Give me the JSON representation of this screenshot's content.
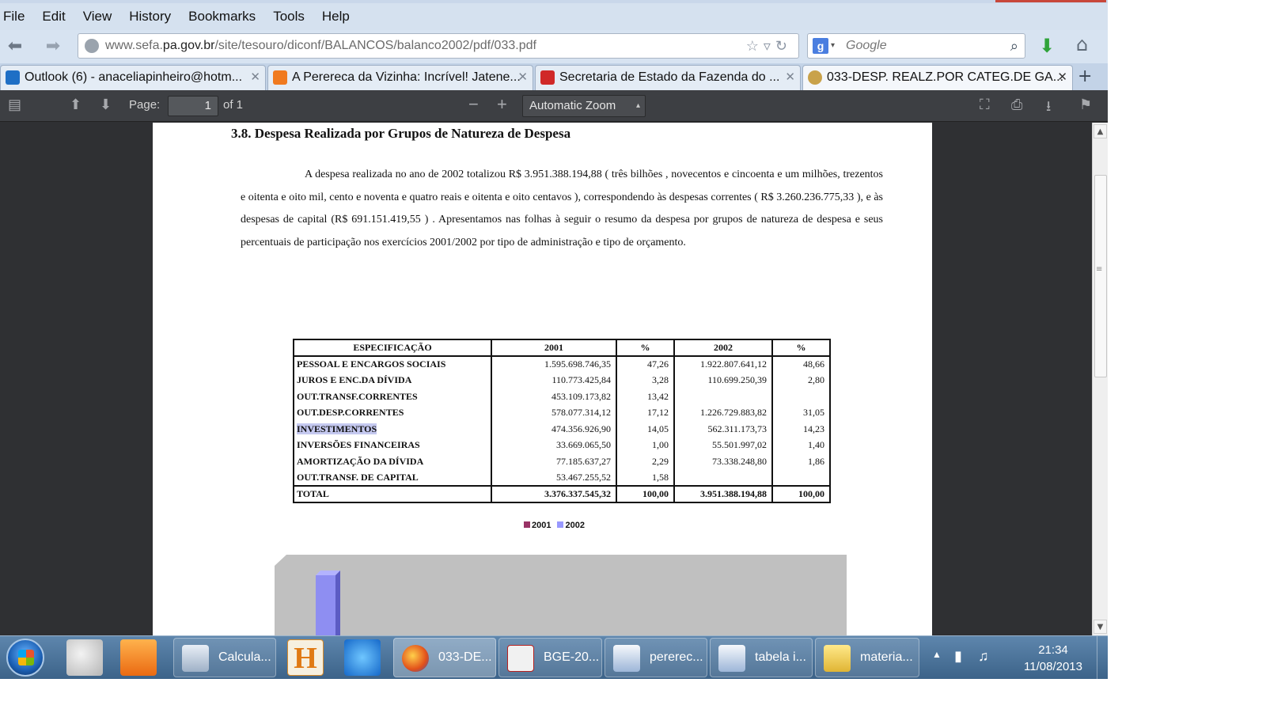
{
  "menu": [
    "File",
    "Edit",
    "View",
    "History",
    "Bookmarks",
    "Tools",
    "Help"
  ],
  "nav": {
    "url_prefix": "www.sefa.",
    "url_host": "pa.gov.br",
    "url_path": "/site/tesouro/diconf/BALANCOS/balanco2002/pdf/033.pdf",
    "search_placeholder": "Google"
  },
  "tabs": [
    {
      "label": "Outlook (6) - anaceliapinheiro@hotm...",
      "color": "#1f6fc5"
    },
    {
      "label": "A Perereca da Vizinha: Incrível! Jatene...",
      "color": "#f07a1f"
    },
    {
      "label": "Secretaria de Estado da Fazenda do ...",
      "color": "#d02828"
    },
    {
      "label": "033-DESP. REALZ.POR CATEG.DE GA...",
      "color": "#c9a24a"
    }
  ],
  "pdf_toolbar": {
    "page_label": "Page:",
    "page_value": "1",
    "page_of": "of 1",
    "zoom": "Automatic Zoom"
  },
  "document": {
    "heading": "3.8.  Despesa Realizada por Grupos de Natureza de Despesa",
    "paragraph": "A despesa realizada no ano de 2002 totalizou R$ 3.951.388.194,88 ( três bilhões , novecentos e cincoenta e um milhões, trezentos e oitenta e oito mil, cento e noventa e quatro reais e oitenta e oito centavos ), correspondendo  às despesas  correntes  ( R$ 3.260.236.775,33 ),  e às despesas de capital (R$ 691.151.419,55 ) . Apresentamos nas folhas à seguir  o  resumo  da  despesa  por  grupos  de  natureza  de  despesa  e  seus  percentuais  de  participação  nos  exercícios 2001/2002 por tipo de administração e tipo de orçamento.",
    "table": {
      "headers": [
        "ESPECIFICAÇÃO",
        "2001",
        "%",
        "2002",
        "%"
      ],
      "rows": [
        [
          "PESSOAL E ENCARGOS SOCIAIS",
          "1.595.698.746,35",
          "47,26",
          "1.922.807.641,12",
          "48,66"
        ],
        [
          "JUROS E ENC.DA DÍVIDA",
          "110.773.425,84",
          "3,28",
          "110.699.250,39",
          "2,80"
        ],
        [
          "OUT.TRANSF.CORRENTES",
          "453.109.173,82",
          "13,42",
          "",
          ""
        ],
        [
          "OUT.DESP.CORRENTES",
          "578.077.314,12",
          "17,12",
          "1.226.729.883,82",
          "31,05"
        ],
        [
          "INVESTIMENTOS",
          "474.356.926,90",
          "14,05",
          "562.311.173,73",
          "14,23"
        ],
        [
          "INVERSÕES FINANCEIRAS",
          "33.669.065,50",
          "1,00",
          "55.501.997,02",
          "1,40"
        ],
        [
          "AMORTIZAÇÃO DA DÍVIDA",
          "77.185.637,27",
          "2,29",
          "73.338.248,80",
          "1,86"
        ],
        [
          "OUT.TRANSF. DE CAPITAL",
          "53.467.255,52",
          "1,58",
          "",
          ""
        ]
      ],
      "total": [
        "TOTAL",
        "3.376.337.545,32",
        "100,00",
        "3.951.388.194,88",
        "100,00"
      ]
    },
    "legend": [
      {
        "label": "2001",
        "color": "#993366"
      },
      {
        "label": "2002",
        "color": "#9999ff"
      }
    ]
  },
  "taskbar": {
    "items": [
      {
        "label": "Calcula...",
        "active": false
      },
      {
        "label": "033-DE...",
        "active": true
      },
      {
        "label": "BGE-20...",
        "active": false
      },
      {
        "label": "pererec...",
        "active": false
      },
      {
        "label": "tabela i...",
        "active": false
      },
      {
        "label": "materia...",
        "active": false
      }
    ],
    "time": "21:34",
    "date": "11/08/2013"
  }
}
